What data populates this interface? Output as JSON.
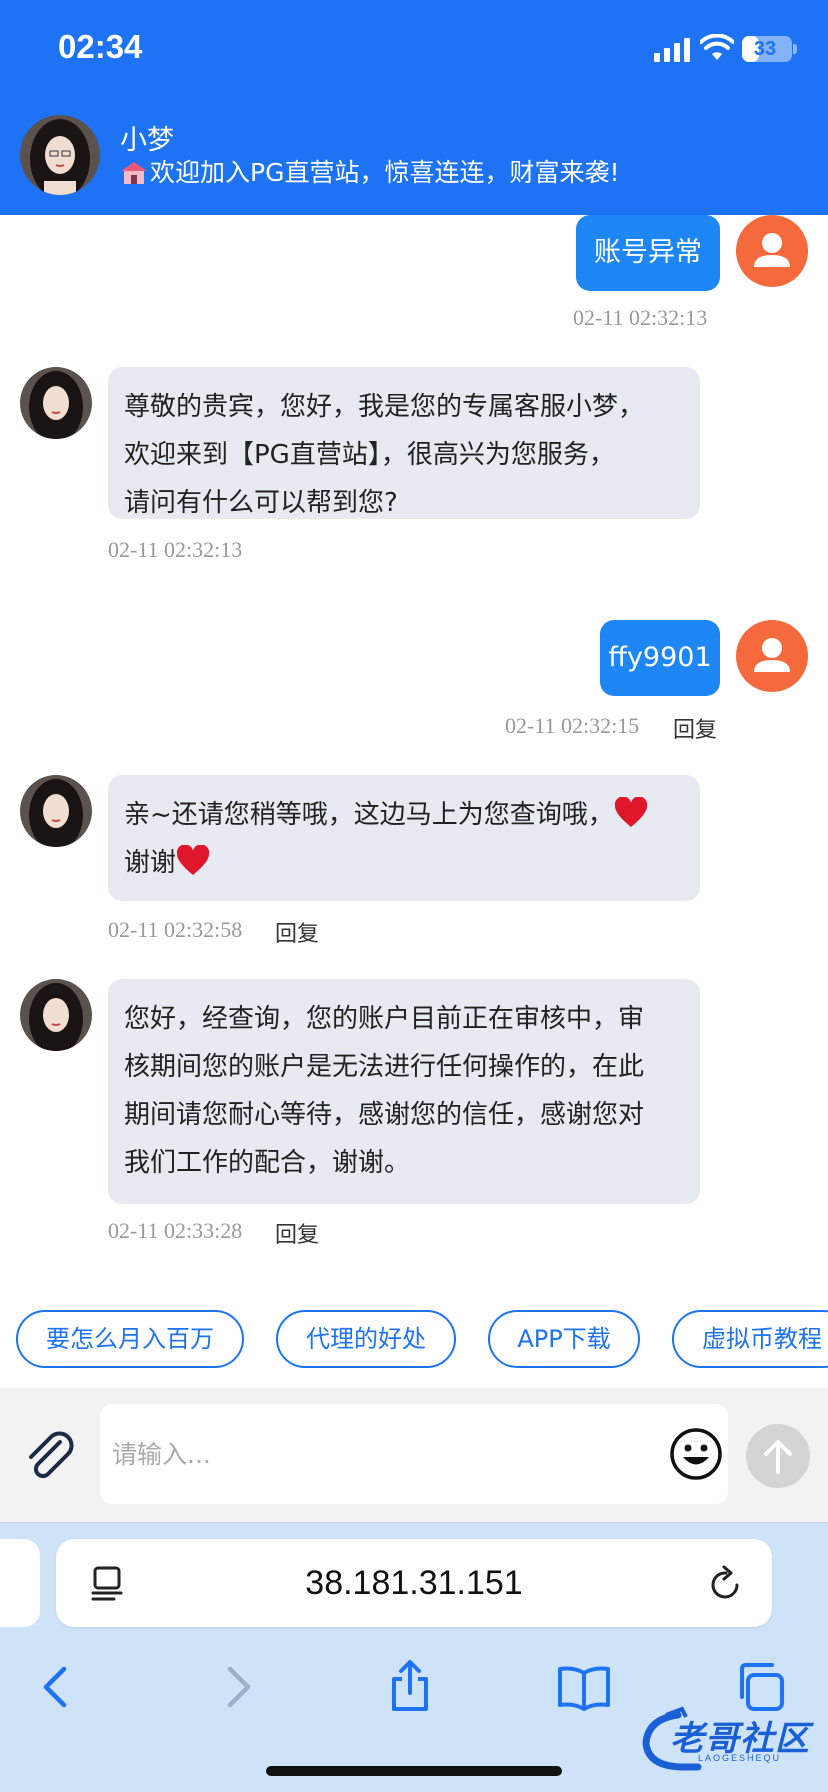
{
  "status_bar": {
    "time": "02:34",
    "battery": "33",
    "battery_level": 0.33
  },
  "header": {
    "agent_name": "小梦",
    "agent_tagline": "欢迎加入PG直营站，惊喜连连，财富来袭!"
  },
  "messages": [
    {
      "side": "me",
      "text": "账号异常",
      "time": "02-11 02:32:13"
    },
    {
      "side": "bot",
      "lines": [
        "尊敬的贵宾，您好，我是您的专属客服小梦，",
        "欢迎来到【PG直营站】，很高兴为您服务，",
        "请问有什么可以帮到您?"
      ],
      "time": "02-11 02:32:13"
    },
    {
      "side": "me",
      "text": "ffy9901",
      "time": "02-11 02:32:15",
      "reply": "回复"
    },
    {
      "side": "bot",
      "lines": [
        "亲~还请您稍等哦，这边马上为您查询哦，",
        "谢谢"
      ],
      "time": "02-11 02:32:58",
      "reply": "回复"
    },
    {
      "side": "bot",
      "lines": [
        "您好，经查询，您的账户目前正在审核中，审",
        "核期间您的账户是无法进行任何操作的，在此",
        "期间请您耐心等待，感谢您的信任，感谢您对",
        "我们工作的配合，谢谢。"
      ],
      "time": "02-11 02:33:28",
      "reply": "回复"
    }
  ],
  "quick_replies": [
    "要怎么月入百万",
    "代理的好处",
    "APP下载",
    "虚拟币教程"
  ],
  "composer": {
    "placeholder": "请输入..."
  },
  "browser": {
    "url": "38.181.31.151"
  },
  "watermark": {
    "text": "老哥社区",
    "sub": "LAOGESHEQU"
  },
  "colors": {
    "header": "#1e73f5",
    "my_bubble": "#1e87f5",
    "bot_bubble": "#e7eaf1",
    "user_avatar": "#f46a3c",
    "browser": "#cfe3f8"
  }
}
